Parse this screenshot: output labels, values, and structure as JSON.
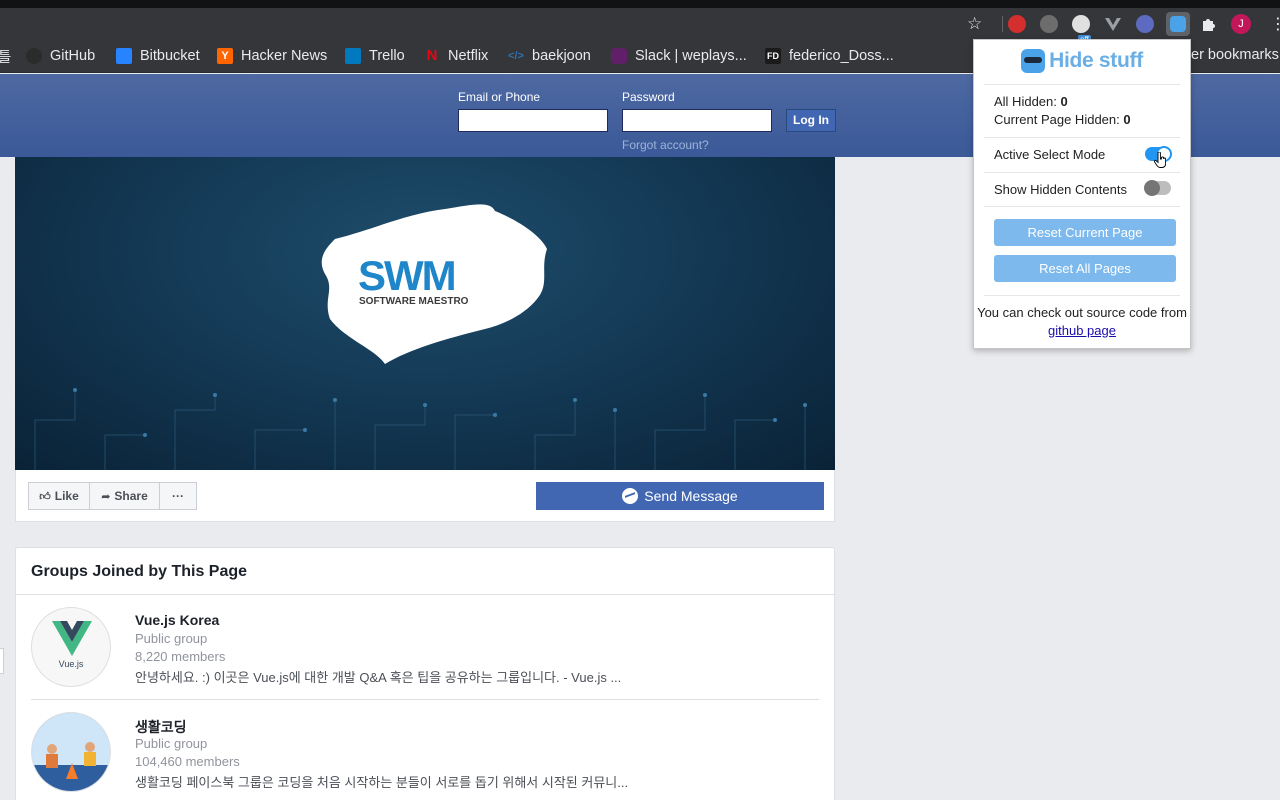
{
  "browser": {
    "bookmarks": [
      {
        "label": "GitHub",
        "icon": "github-icon",
        "color": "#2b2b2b"
      },
      {
        "label": "Bitbucket",
        "icon": "bitbucket-icon",
        "color": "#2684ff"
      },
      {
        "label": "Hacker News",
        "icon": "hacker-news-icon",
        "color": "#ff6600",
        "glyph": "Y"
      },
      {
        "label": "Trello",
        "icon": "trello-icon",
        "color": "#0079bf"
      },
      {
        "label": "Netflix",
        "icon": "netflix-icon",
        "color": "#e50914"
      },
      {
        "label": "baekjoon",
        "icon": "baekjoon-icon",
        "color": "#0076c0"
      },
      {
        "label": "Slack | weplays...",
        "icon": "slack-icon",
        "color": "#611f69"
      },
      {
        "label": "federico_Doss...",
        "icon": "fd-icon",
        "color": "#1b1b1b",
        "glyph": "FD"
      }
    ],
    "other_bookmarks": "er bookmarks",
    "extension_badge": "off",
    "profile_initial": "J"
  },
  "fb_header": {
    "email_label": "Email or Phone",
    "password_label": "Password",
    "login_button": "Log In",
    "forgot_link": "Forgot account?"
  },
  "cover": {
    "logo_main": "SWM",
    "logo_sub": "SOFTWARE MAESTRO"
  },
  "actions": {
    "like": "Like",
    "share": "Share",
    "more": "···",
    "send_message": "Send Message"
  },
  "groups": {
    "title": "Groups Joined by This Page",
    "items": [
      {
        "name": "Vue.js Korea",
        "type": "Public group",
        "members": "8,220 members",
        "description": "안녕하세요. :) 이곳은 Vue.js에 대한 개발 Q&A 혹은 팁을 공유하는 그룹입니다. - Vue.js ...",
        "avatar_text": "Vue.js"
      },
      {
        "name": "생활코딩",
        "type": "Public group",
        "members": "104,460 members",
        "description": "생활코딩 페이스북 그룹은 코딩을 처음 시작하는 분들이 서로를 돕기 위해서 시작된 커뮤니..."
      }
    ]
  },
  "popup": {
    "title": "Hide stuff",
    "all_hidden_label": "All Hidden:",
    "all_hidden_value": "0",
    "current_hidden_label": "Current Page Hidden:",
    "current_hidden_value": "0",
    "active_select_label": "Active Select Mode",
    "active_select_on": true,
    "show_hidden_label": "Show Hidden Contents",
    "show_hidden_on": false,
    "reset_current": "Reset Current Page",
    "reset_all": "Reset All Pages",
    "footer_text": "You can check out source code from",
    "footer_link": "github page"
  },
  "colors": {
    "fb_blue": "#4267b2",
    "popup_accent": "#7db9ec",
    "toggle_on": "#2196f3"
  }
}
